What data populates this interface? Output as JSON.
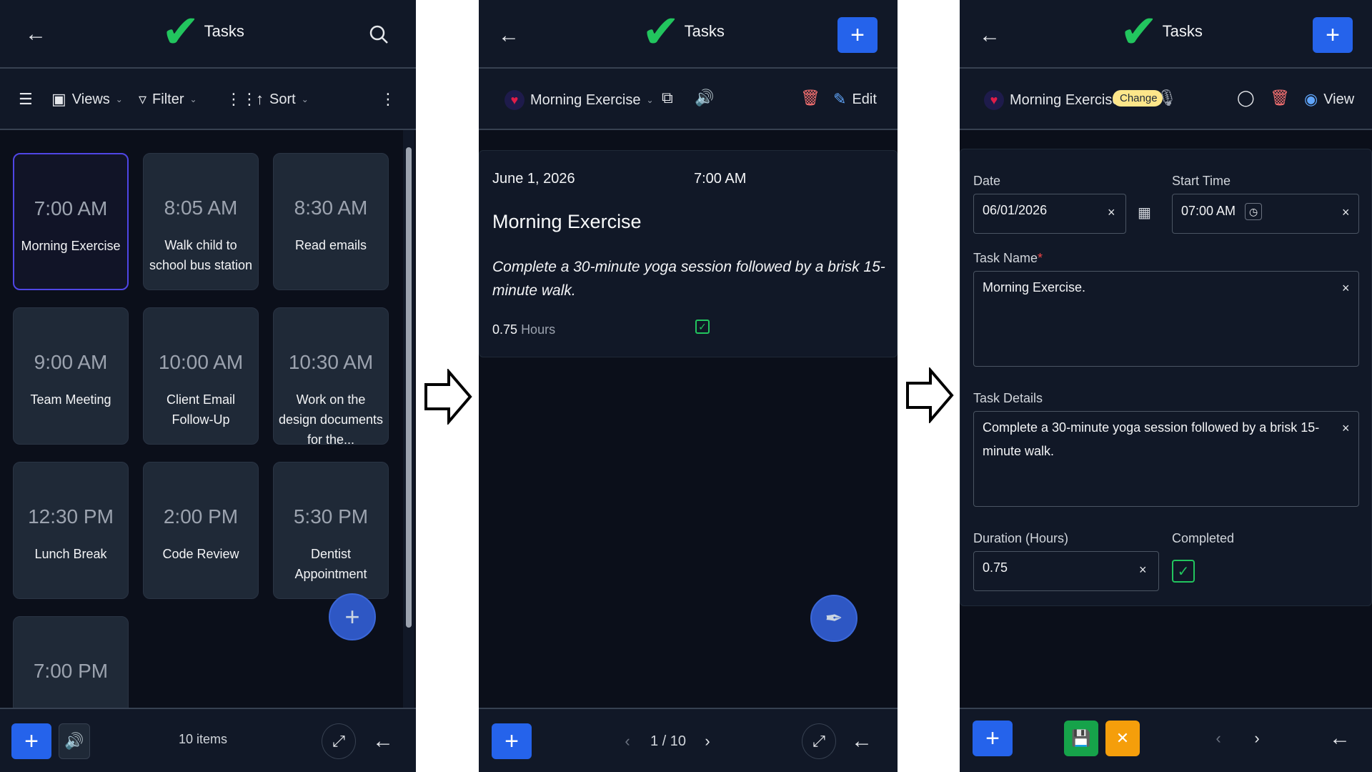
{
  "app": {
    "title": "Tasks"
  },
  "colors": {
    "accent": "#2563eb",
    "brand_check": "#22c55e",
    "bg": "#0b0f1a",
    "panel": "#111827"
  },
  "list_view": {
    "toolbar": {
      "views": "Views",
      "filter": "Filter",
      "sort": "Sort"
    },
    "cards": [
      {
        "time": "7:00 AM",
        "name": "Morning Exercise",
        "selected": true
      },
      {
        "time": "8:05 AM",
        "name": "Walk child to school bus station"
      },
      {
        "time": "8:30 AM",
        "name": "Read emails"
      },
      {
        "time": "9:00 AM",
        "name": "Team Meeting"
      },
      {
        "time": "10:00 AM",
        "name": "Client Email Follow-Up"
      },
      {
        "time": "10:30 AM",
        "name": "Work on the design documents for the..."
      },
      {
        "time": "12:30 PM",
        "name": "Lunch Break"
      },
      {
        "time": "2:00 PM",
        "name": "Code Review"
      },
      {
        "time": "5:30 PM",
        "name": "Dentist Appointment"
      },
      {
        "time": "7:00 PM",
        "name": ""
      }
    ],
    "item_count": "10 items"
  },
  "detail_view": {
    "task_selector": "Morning Exercise",
    "edit_label": "Edit",
    "date": "June 1, 2026",
    "time": "7:00 AM",
    "task_name": "Morning Exercise",
    "task_details": "Complete a 30-minute yoga session followed by a brisk 15-minute walk.",
    "duration_value": "0.75",
    "duration_unit": "Hours",
    "pager": "1 / 10"
  },
  "edit_view": {
    "task_selector": "Morning Exercise.",
    "change_badge": "Change",
    "view_label": "View",
    "date_label": "Date",
    "date_value": "06/01/2026",
    "start_time_label": "Start Time",
    "start_time_value": "07:00 AM",
    "task_name_label": "Task Name",
    "required_mark": "*",
    "task_name_value": "Morning Exercise.",
    "task_details_label": "Task Details",
    "task_details_value": "Complete a 30-minute yoga session followed by a brisk 15-minute walk.",
    "duration_label": "Duration (Hours)",
    "duration_value": "0.75",
    "completed_label": "Completed",
    "completed": true
  }
}
